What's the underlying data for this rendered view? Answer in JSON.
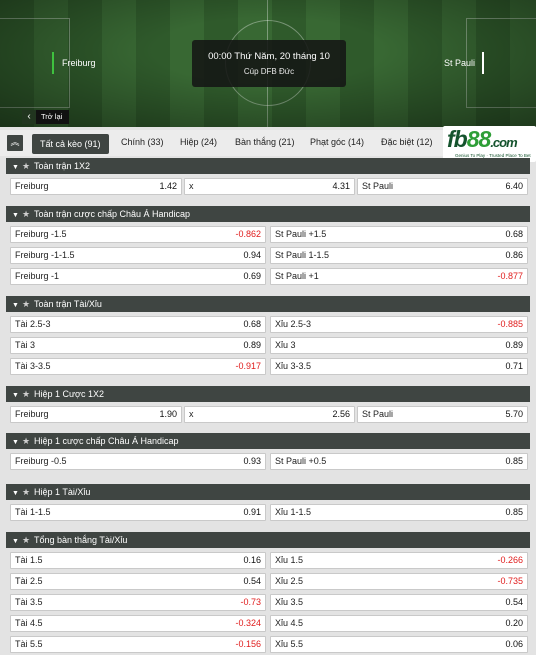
{
  "match": {
    "home": "Freiburg",
    "away": "St Pauli",
    "time": "00:00 Thứ Năm, 20 tháng 10",
    "league": "Cúp DFB Đức"
  },
  "back_label": "Trở lại",
  "logo": {
    "brand": "fb",
    "brand_accent": "88",
    "suffix": ".com",
    "tagline": "Genius To Play  ·  Trusted Place To Bet"
  },
  "tabs": [
    {
      "label": "Tất cả kèo (91)"
    },
    {
      "label": "Chính (33)"
    },
    {
      "label": "Hiệp (24)"
    },
    {
      "label": "Bàn thắng (21)"
    },
    {
      "label": "Phạt góc (14)"
    },
    {
      "label": "Đặc biệt (12)"
    }
  ],
  "markets": [
    {
      "title": "Toàn trận 1X2",
      "rows": [
        [
          [
            "Freiburg",
            "1.42"
          ],
          [
            "x",
            "4.31"
          ],
          [
            "St Pauli",
            "6.40"
          ]
        ]
      ]
    },
    {
      "title": "Toàn trận cược chấp Châu Á Handicap",
      "rows": [
        [
          [
            "Freiburg -1.5",
            "-0.862"
          ],
          [
            "St Pauli +1.5",
            "0.68"
          ]
        ],
        [
          [
            "Freiburg -1-1.5",
            "0.94"
          ],
          [
            "St Pauli 1-1.5",
            "0.86"
          ]
        ],
        [
          [
            "Freiburg -1",
            "0.69"
          ],
          [
            "St Pauli +1",
            "-0.877"
          ]
        ]
      ]
    },
    {
      "title": "Toàn trận Tài/Xỉu",
      "rows": [
        [
          [
            "Tài 2.5-3",
            "0.68"
          ],
          [
            "Xỉu 2.5-3",
            "-0.885"
          ]
        ],
        [
          [
            "Tài 3",
            "0.89"
          ],
          [
            "Xỉu 3",
            "0.89"
          ]
        ],
        [
          [
            "Tài 3-3.5",
            "-0.917"
          ],
          [
            "Xỉu 3-3.5",
            "0.71"
          ]
        ]
      ]
    },
    {
      "title": "Hiệp 1 Cược 1X2",
      "rows": [
        [
          [
            "Freiburg",
            "1.90"
          ],
          [
            "x",
            "2.56"
          ],
          [
            "St Pauli",
            "5.70"
          ]
        ]
      ]
    },
    {
      "title": "Hiệp 1 cược chấp Châu Á Handicap",
      "rows": [
        [
          [
            "Freiburg -0.5",
            "0.93"
          ],
          [
            "St Pauli +0.5",
            "0.85"
          ]
        ]
      ]
    },
    {
      "title": "Hiệp 1 Tài/Xỉu",
      "rows": [
        [
          [
            "Tài 1-1.5",
            "0.91"
          ],
          [
            "Xỉu 1-1.5",
            "0.85"
          ]
        ]
      ]
    },
    {
      "title": "Tổng bàn thắng Tài/Xỉu",
      "rows": [
        [
          [
            "Tài 1.5",
            "0.16"
          ],
          [
            "Xỉu 1.5",
            "-0.266"
          ]
        ],
        [
          [
            "Tài 2.5",
            "0.54"
          ],
          [
            "Xỉu 2.5",
            "-0.735"
          ]
        ],
        [
          [
            "Tài 3.5",
            "-0.73"
          ],
          [
            "Xỉu 3.5",
            "0.54"
          ]
        ],
        [
          [
            "Tài 4.5",
            "-0.324"
          ],
          [
            "Xỉu 4.5",
            "0.20"
          ]
        ],
        [
          [
            "Tài 5.5",
            "-0.156"
          ],
          [
            "Xỉu 5.5",
            "0.06"
          ]
        ]
      ]
    }
  ]
}
